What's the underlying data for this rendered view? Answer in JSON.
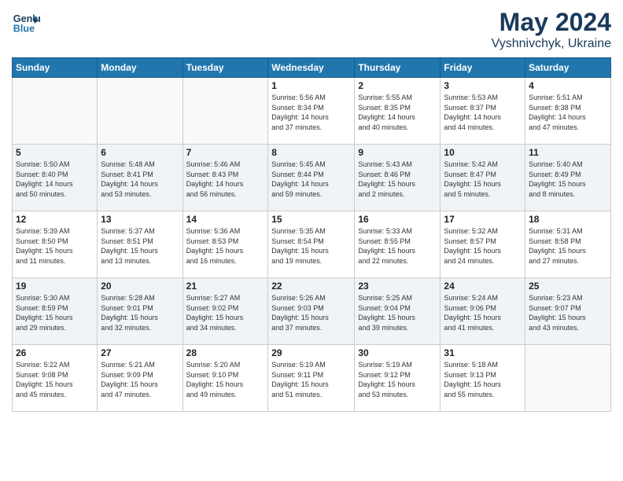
{
  "header": {
    "logo_line1": "General",
    "logo_line2": "Blue",
    "title": "May 2024",
    "subtitle": "Vyshnivchyk, Ukraine"
  },
  "days_of_week": [
    "Sunday",
    "Monday",
    "Tuesday",
    "Wednesday",
    "Thursday",
    "Friday",
    "Saturday"
  ],
  "weeks": [
    [
      {
        "day": "",
        "info": ""
      },
      {
        "day": "",
        "info": ""
      },
      {
        "day": "",
        "info": ""
      },
      {
        "day": "1",
        "info": "Sunrise: 5:56 AM\nSunset: 8:34 PM\nDaylight: 14 hours\nand 37 minutes."
      },
      {
        "day": "2",
        "info": "Sunrise: 5:55 AM\nSunset: 8:35 PM\nDaylight: 14 hours\nand 40 minutes."
      },
      {
        "day": "3",
        "info": "Sunrise: 5:53 AM\nSunset: 8:37 PM\nDaylight: 14 hours\nand 44 minutes."
      },
      {
        "day": "4",
        "info": "Sunrise: 5:51 AM\nSunset: 8:38 PM\nDaylight: 14 hours\nand 47 minutes."
      }
    ],
    [
      {
        "day": "5",
        "info": "Sunrise: 5:50 AM\nSunset: 8:40 PM\nDaylight: 14 hours\nand 50 minutes."
      },
      {
        "day": "6",
        "info": "Sunrise: 5:48 AM\nSunset: 8:41 PM\nDaylight: 14 hours\nand 53 minutes."
      },
      {
        "day": "7",
        "info": "Sunrise: 5:46 AM\nSunset: 8:43 PM\nDaylight: 14 hours\nand 56 minutes."
      },
      {
        "day": "8",
        "info": "Sunrise: 5:45 AM\nSunset: 8:44 PM\nDaylight: 14 hours\nand 59 minutes."
      },
      {
        "day": "9",
        "info": "Sunrise: 5:43 AM\nSunset: 8:46 PM\nDaylight: 15 hours\nand 2 minutes."
      },
      {
        "day": "10",
        "info": "Sunrise: 5:42 AM\nSunset: 8:47 PM\nDaylight: 15 hours\nand 5 minutes."
      },
      {
        "day": "11",
        "info": "Sunrise: 5:40 AM\nSunset: 8:49 PM\nDaylight: 15 hours\nand 8 minutes."
      }
    ],
    [
      {
        "day": "12",
        "info": "Sunrise: 5:39 AM\nSunset: 8:50 PM\nDaylight: 15 hours\nand 11 minutes."
      },
      {
        "day": "13",
        "info": "Sunrise: 5:37 AM\nSunset: 8:51 PM\nDaylight: 15 hours\nand 13 minutes."
      },
      {
        "day": "14",
        "info": "Sunrise: 5:36 AM\nSunset: 8:53 PM\nDaylight: 15 hours\nand 16 minutes."
      },
      {
        "day": "15",
        "info": "Sunrise: 5:35 AM\nSunset: 8:54 PM\nDaylight: 15 hours\nand 19 minutes."
      },
      {
        "day": "16",
        "info": "Sunrise: 5:33 AM\nSunset: 8:55 PM\nDaylight: 15 hours\nand 22 minutes."
      },
      {
        "day": "17",
        "info": "Sunrise: 5:32 AM\nSunset: 8:57 PM\nDaylight: 15 hours\nand 24 minutes."
      },
      {
        "day": "18",
        "info": "Sunrise: 5:31 AM\nSunset: 8:58 PM\nDaylight: 15 hours\nand 27 minutes."
      }
    ],
    [
      {
        "day": "19",
        "info": "Sunrise: 5:30 AM\nSunset: 8:59 PM\nDaylight: 15 hours\nand 29 minutes."
      },
      {
        "day": "20",
        "info": "Sunrise: 5:28 AM\nSunset: 9:01 PM\nDaylight: 15 hours\nand 32 minutes."
      },
      {
        "day": "21",
        "info": "Sunrise: 5:27 AM\nSunset: 9:02 PM\nDaylight: 15 hours\nand 34 minutes."
      },
      {
        "day": "22",
        "info": "Sunrise: 5:26 AM\nSunset: 9:03 PM\nDaylight: 15 hours\nand 37 minutes."
      },
      {
        "day": "23",
        "info": "Sunrise: 5:25 AM\nSunset: 9:04 PM\nDaylight: 15 hours\nand 39 minutes."
      },
      {
        "day": "24",
        "info": "Sunrise: 5:24 AM\nSunset: 9:06 PM\nDaylight: 15 hours\nand 41 minutes."
      },
      {
        "day": "25",
        "info": "Sunrise: 5:23 AM\nSunset: 9:07 PM\nDaylight: 15 hours\nand 43 minutes."
      }
    ],
    [
      {
        "day": "26",
        "info": "Sunrise: 5:22 AM\nSunset: 9:08 PM\nDaylight: 15 hours\nand 45 minutes."
      },
      {
        "day": "27",
        "info": "Sunrise: 5:21 AM\nSunset: 9:09 PM\nDaylight: 15 hours\nand 47 minutes."
      },
      {
        "day": "28",
        "info": "Sunrise: 5:20 AM\nSunset: 9:10 PM\nDaylight: 15 hours\nand 49 minutes."
      },
      {
        "day": "29",
        "info": "Sunrise: 5:19 AM\nSunset: 9:11 PM\nDaylight: 15 hours\nand 51 minutes."
      },
      {
        "day": "30",
        "info": "Sunrise: 5:19 AM\nSunset: 9:12 PM\nDaylight: 15 hours\nand 53 minutes."
      },
      {
        "day": "31",
        "info": "Sunrise: 5:18 AM\nSunset: 9:13 PM\nDaylight: 15 hours\nand 55 minutes."
      },
      {
        "day": "",
        "info": ""
      }
    ]
  ]
}
